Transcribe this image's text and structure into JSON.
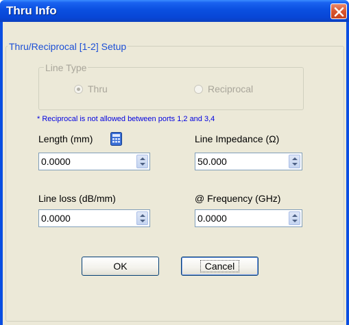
{
  "window": {
    "title": "Thru Info"
  },
  "group": {
    "title": "Thru/Reciprocal [1-2] Setup"
  },
  "line_type": {
    "title": "Line Type",
    "options": [
      {
        "label": "Thru",
        "selected": true,
        "enabled": false
      },
      {
        "label": "Reciprocal",
        "selected": false,
        "enabled": false
      }
    ]
  },
  "note": "* Reciprocal is not allowed between ports 1,2 and 3,4",
  "fields": {
    "length": {
      "label": "Length (mm)",
      "value": "0.0000"
    },
    "impedance": {
      "label": "Line Impedance (Ω)",
      "value": "50.000"
    },
    "loss": {
      "label": "Line loss (dB/mm)",
      "value": "0.0000"
    },
    "frequency": {
      "label": "@ Frequency (GHz)",
      "value": "0.0000"
    }
  },
  "buttons": {
    "ok": "OK",
    "cancel": "Cancel"
  },
  "icons": {
    "close": "close-icon",
    "calculator": "calculator-icon"
  },
  "colors": {
    "titlebar": "#0a4fe0",
    "note": "#0000e0",
    "group_title": "#1c4fd6",
    "face": "#ece9d8"
  }
}
